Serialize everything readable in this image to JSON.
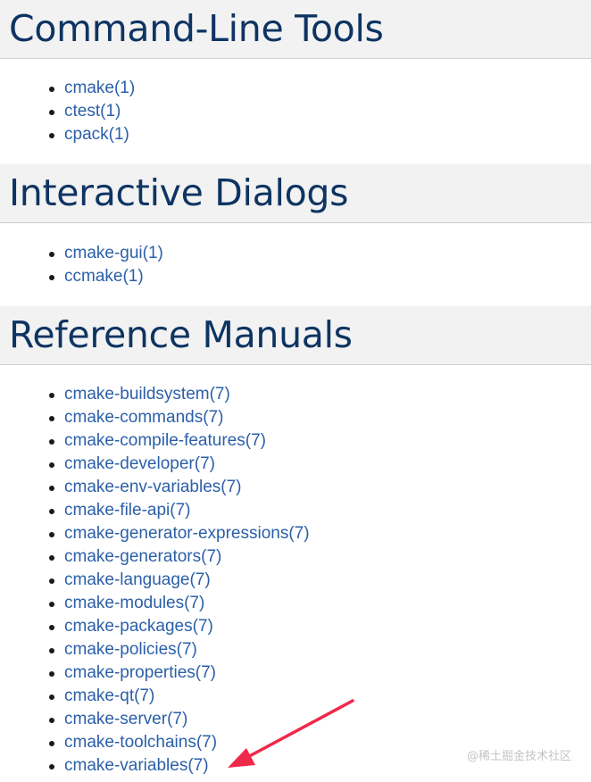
{
  "sections": [
    {
      "title": "Command-Line Tools",
      "items": [
        "cmake(1)",
        "ctest(1)",
        "cpack(1)"
      ]
    },
    {
      "title": "Interactive Dialogs",
      "items": [
        "cmake-gui(1)",
        "ccmake(1)"
      ]
    },
    {
      "title": "Reference Manuals",
      "items": [
        "cmake-buildsystem(7)",
        "cmake-commands(7)",
        "cmake-compile-features(7)",
        "cmake-developer(7)",
        "cmake-env-variables(7)",
        "cmake-file-api(7)",
        "cmake-generator-expressions(7)",
        "cmake-generators(7)",
        "cmake-language(7)",
        "cmake-modules(7)",
        "cmake-packages(7)",
        "cmake-policies(7)",
        "cmake-properties(7)",
        "cmake-qt(7)",
        "cmake-server(7)",
        "cmake-toolchains(7)",
        "cmake-variables(7)"
      ]
    }
  ],
  "watermark": "@稀土掘金技术社区",
  "annotation": {
    "type": "arrow",
    "color": "#f0284a",
    "points_to": "cmake-variables(7)"
  }
}
